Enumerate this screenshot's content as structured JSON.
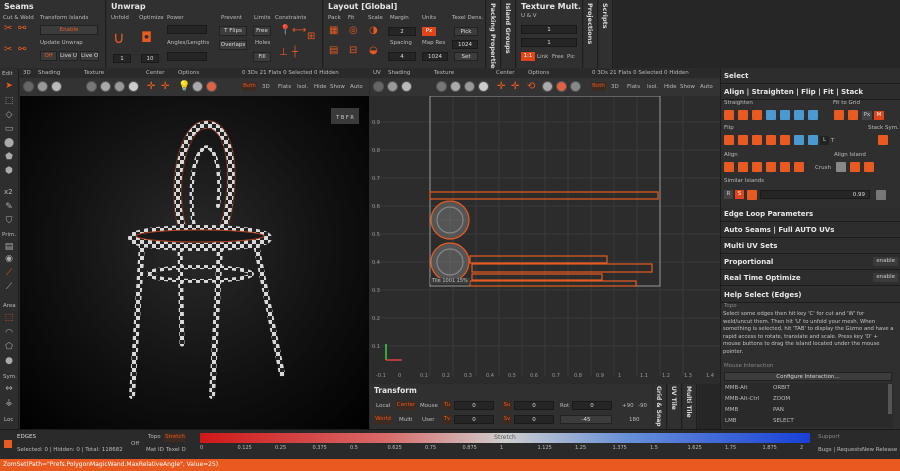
{
  "top": {
    "seams": {
      "title": "Seams",
      "cut_weld": "Cut & Weld",
      "transform_islands": "Transform Islands",
      "enable": "Enable",
      "update_unwrap": "Update Unwrap",
      "off": "Off",
      "live_u": "Live U",
      "live_o": "Live O"
    },
    "unwrap": {
      "title": "Unwrap",
      "unfold": "Unfold",
      "optimize": "Optimize",
      "power": "Power",
      "prevent": "Prevent",
      "limits": "Limits",
      "constraints": "Constraints",
      "angles_lengths": "Angles/Lengths",
      "t_flips": "T Flips",
      "free": "Free",
      "overlaps": "Overlaps",
      "holes": "Holes",
      "fill": "Fill",
      "v1": "1",
      "v10": "10"
    },
    "layout": {
      "title": "Layout [Global]",
      "pack": "Pack",
      "fit": "Fit",
      "scale": "Scale",
      "margin": "Margin",
      "units": "Units",
      "texel_dens": "Texel Dens.",
      "spacing": "Spacing",
      "map_res": "Map Res",
      "px": "Px",
      "pick": "Pick",
      "set": "Set",
      "v2": "2",
      "v4": "4",
      "v1024a": "1024",
      "v1024b": "1024"
    },
    "packing_properties": "Packing Properties [",
    "island_groups": "Island Groups",
    "texture_mult": {
      "title": "Texture Mult.",
      "uv": "U & V",
      "v1a": "1",
      "v1b": "1",
      "v1c": "1:1",
      "link": "Link",
      "free": "Free",
      "pic": "Pic"
    },
    "projections": "Projections",
    "scripts": "Scripts"
  },
  "viewport3d": {
    "edit": "Edit",
    "tabs": [
      "3D",
      "Shading",
      "Texture",
      "Center",
      "Options"
    ],
    "info": "0 3Ds 21 Flats   0 Selected   0 Hidden",
    "both": "Both",
    "mode_3d": "3D",
    "flats": "Flats",
    "isol": "Isol.",
    "hide": "Hide",
    "show": "Show",
    "auto": "Auto",
    "prim": "Prim.",
    "area": "Area",
    "sym": "Sym.",
    "loc": "Loc",
    "x2": "x2"
  },
  "viewportuv": {
    "tabs": [
      "UV",
      "Shading",
      "Texture",
      "Center",
      "Options"
    ],
    "info": "0 3Ds 21 Flats   0 Selected   0 Hidden",
    "both": "Both",
    "mode_3d": "3D",
    "flats": "Flats",
    "isol": "Isol.",
    "hide": "Hide",
    "show": "Show",
    "auto": "Auto",
    "tile_label": "Tile 1001 15%",
    "y_ticks": [
      "0.9",
      "0.8",
      "0.7",
      "0.6",
      "0.5",
      "0.4",
      "0.3",
      "0.2",
      "0.1"
    ],
    "x_ticks": [
      "-0.1",
      "0",
      "0.1",
      "0.2",
      "0.3",
      "0.4",
      "0.5",
      "0.6",
      "0.7",
      "0.8",
      "0.9",
      "1",
      "1.1",
      "1.2",
      "1.3",
      "1.4"
    ]
  },
  "transform": {
    "title": "Transform",
    "local": "Local",
    "center": "Center",
    "mouse": "Mouse",
    "world": "World",
    "multi": "Multi",
    "user": "User",
    "tu": "Tu",
    "tv": "Tv",
    "su": "Su",
    "sv": "Sv",
    "rot": "Rot",
    "v0a": "0",
    "v0b": "0",
    "v0c": "0",
    "v0d": "0",
    "v0e": "0",
    "v45": "-45",
    "v90a": "+90",
    "v90b": "-90",
    "v180": "180",
    "grid_snap": "Grid & Snap",
    "uv_tile": "UV Tile",
    "multi_tile": "Multi Tile"
  },
  "right": {
    "select": "Select",
    "align": "Align | Straighten | Flip | Fit | Stack",
    "straighten": "Straighten",
    "fit_to_grid": "Fit to Grid",
    "flip": "Flip",
    "stack_sym": "Stack Sym.",
    "align_lbl": "Align",
    "align_island": "Align Island",
    "crush": "Crush",
    "similar_islands": "Similar Islands",
    "r": "R",
    "s": "S",
    "similarity": "0.99",
    "l": "L",
    "t": "T",
    "edge_loop": "Edge Loop Parameters",
    "auto_seams": "Auto Seams | Full AUTO UVs",
    "multi_uv": "Multi UV Sets",
    "proportional": "Proportional",
    "real_time": "Real Time Optimize",
    "enable_a": "enable",
    "enable_b": "enable",
    "help_title": "Help Select (Edges)",
    "topo": "Topo",
    "help_text": "Select some edges then hit key 'C' for cut and 'W' for weld/uncut them. Then hit 'U' to unfold your mesh. When something is selected, hit 'TAB' to display the Gizmo and have a rapid access to rotate, translate and scale. Press key 'D' + mouse buttons to drag the island located under the mouse pointer.",
    "mouse_interaction": "Mouse Interaction",
    "configure": "Configure Interaction...",
    "bindings": [
      {
        "key": "MMB-Alt",
        "action": "ORBIT"
      },
      {
        "key": "MMB-Alt-Ctrl",
        "action": "ZOOM"
      },
      {
        "key": "MMB",
        "action": "PAN"
      },
      {
        "key": "LMB",
        "action": "SELECT"
      }
    ]
  },
  "status": {
    "mode": "EDGES",
    "counts": "Selected: 0 | Hidden: 0 | Total: 118682",
    "off": "Off",
    "topo": "Topo",
    "stretch": "Stretch",
    "mat_id": "Mat ID",
    "texel": "Texel D",
    "bar_label": "Stretch",
    "scale_ticks": [
      "0",
      "0.125",
      "0.25",
      "0.375",
      "0.5",
      "0.625",
      "0.75",
      "0.875",
      "1",
      "1.125",
      "1.25",
      "1.375",
      "1.5",
      "1.625",
      "1.75",
      "1.875",
      "2"
    ],
    "support": "Support",
    "bugs": "Bugs | Requests",
    "new_release": "New Release"
  },
  "command": "ZomSet(Path=\"Prefs.PolygonMagicWand.MaxRelativeAngle\", Value=25)",
  "colors": {
    "accent": "#e85a20",
    "panel": "#303030",
    "bg": "#2b2b2b"
  }
}
